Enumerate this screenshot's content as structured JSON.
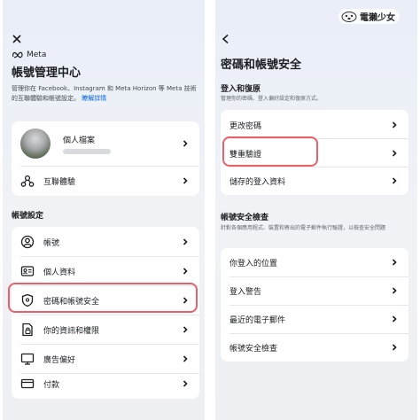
{
  "left": {
    "brand": "Meta",
    "title": "帳號管理中心",
    "description": "管理你在 Facebook、Instagram 和 Meta Horizon 等 Meta 技術的互聯體驗和帳號設定。",
    "learn_more": "瞭解詳情",
    "profile_label": "個人檔案",
    "connected_label": "互聯體驗",
    "account_settings_title": "帳號設定",
    "settings_items": [
      {
        "label": "帳號",
        "icon": "user-circle-icon"
      },
      {
        "label": "個人資料",
        "icon": "id-card-icon"
      },
      {
        "label": "密碼和帳號安全",
        "icon": "shield-icon"
      },
      {
        "label": "你的資訊和權限",
        "icon": "document-lock-icon"
      },
      {
        "label": "廣告偏好",
        "icon": "monitor-icon"
      },
      {
        "label": "付款",
        "icon": "credit-card-icon"
      }
    ]
  },
  "right": {
    "title": "密碼和帳號安全",
    "login_section_title": "登入和復原",
    "login_section_sub": "管理你的密碼、登入偏好設定和復原方式。",
    "login_items": [
      "更改密碼",
      "雙重驗證",
      "儲存的登入資料"
    ],
    "security_section_title": "帳號安全檢查",
    "security_section_sub": "針對各個應用程式、裝置和寄出的電子郵件執行驗證，以檢查安全問題",
    "security_items": [
      "你登入的位置",
      "登入警告",
      "最近的電子郵件",
      "帳號安全檢查"
    ]
  },
  "watermark": "電獺少女",
  "colors": {
    "link": "#0064e0",
    "highlight": "#e8606b",
    "background": "#eef0f5"
  }
}
